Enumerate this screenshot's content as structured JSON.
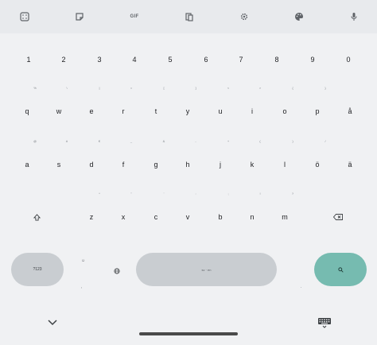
{
  "toolbar": {
    "items": [
      {
        "name": "emoji-grid",
        "label": ""
      },
      {
        "name": "sticker",
        "label": ""
      },
      {
        "name": "gif",
        "label": "GIF"
      },
      {
        "name": "clipboard",
        "label": ""
      },
      {
        "name": "settings",
        "label": ""
      },
      {
        "name": "theme",
        "label": ""
      },
      {
        "name": "mic",
        "label": ""
      }
    ]
  },
  "rows": [
    {
      "keys": [
        {
          "main": "1",
          "hint": ""
        },
        {
          "main": "2",
          "hint": ""
        },
        {
          "main": "3",
          "hint": ""
        },
        {
          "main": "4",
          "hint": ""
        },
        {
          "main": "5",
          "hint": ""
        },
        {
          "main": "6",
          "hint": ""
        },
        {
          "main": "7",
          "hint": ""
        },
        {
          "main": "8",
          "hint": ""
        },
        {
          "main": "9",
          "hint": ""
        },
        {
          "main": "0",
          "hint": ""
        }
      ]
    },
    {
      "keys": [
        {
          "main": "q",
          "hint": "%"
        },
        {
          "main": "w",
          "hint": "\\"
        },
        {
          "main": "e",
          "hint": "|"
        },
        {
          "main": "r",
          "hint": "="
        },
        {
          "main": "t",
          "hint": "["
        },
        {
          "main": "y",
          "hint": "]"
        },
        {
          "main": "u",
          "hint": "<"
        },
        {
          "main": "i",
          "hint": ">"
        },
        {
          "main": "o",
          "hint": "{"
        },
        {
          "main": "p",
          "hint": "}"
        },
        {
          "main": "å",
          "hint": ""
        }
      ]
    },
    {
      "keys": [
        {
          "main": "a",
          "hint": "@"
        },
        {
          "main": "s",
          "hint": "#"
        },
        {
          "main": "d",
          "hint": "€"
        },
        {
          "main": "f",
          "hint": "_"
        },
        {
          "main": "g",
          "hint": "&"
        },
        {
          "main": "h",
          "hint": "-"
        },
        {
          "main": "j",
          "hint": "+"
        },
        {
          "main": "k",
          "hint": "("
        },
        {
          "main": "l",
          "hint": ")"
        },
        {
          "main": "ö",
          "hint": "/"
        },
        {
          "main": "ä",
          "hint": ""
        }
      ]
    },
    {
      "keys": [
        {
          "main": "z",
          "hint": "*"
        },
        {
          "main": "x",
          "hint": "\""
        },
        {
          "main": "c",
          "hint": "'"
        },
        {
          "main": "v",
          "hint": ":"
        },
        {
          "main": "b",
          "hint": ";"
        },
        {
          "main": "n",
          "hint": "!"
        },
        {
          "main": "m",
          "hint": "?"
        }
      ]
    }
  ],
  "bottom": {
    "symbols_label": "?123",
    "comma_top": "☺",
    "comma_bottom": ",",
    "space_label": "sv · en",
    "period_top": "",
    "period_bottom": "."
  },
  "colors": {
    "background": "#f0f1f3",
    "toolbar": "#e8eaed",
    "pill_key": "#c9cdd1",
    "action_key": "#76bbb0"
  }
}
